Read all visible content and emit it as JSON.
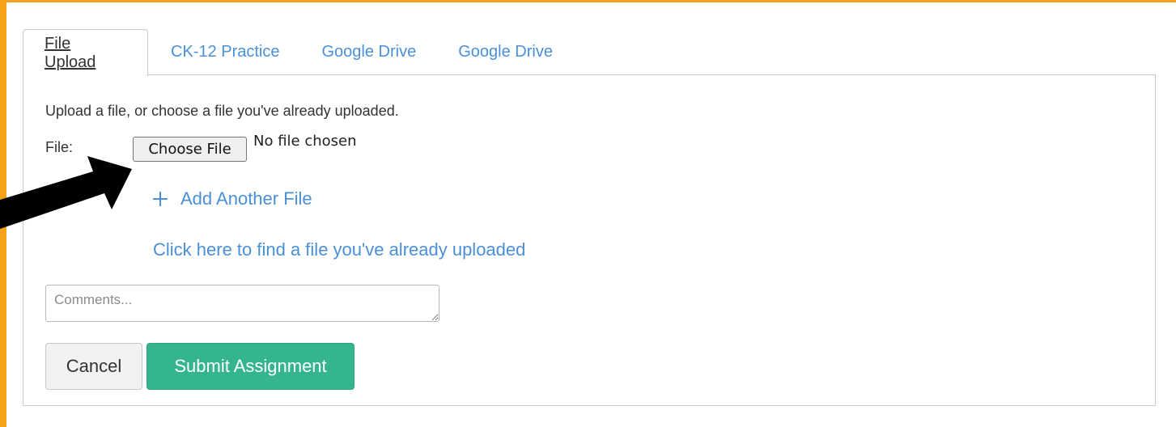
{
  "tabs": [
    {
      "label": "File Upload",
      "active": true
    },
    {
      "label": "CK-12 Practice",
      "active": false
    },
    {
      "label": "Google Drive",
      "active": false
    },
    {
      "label": "Google Drive",
      "active": false
    }
  ],
  "upload": {
    "instructions": "Upload a file, or choose a file you've already uploaded.",
    "file_label": "File:",
    "choose_file_label": "Choose File",
    "no_file_text": "No file chosen",
    "add_another_label": "Add Another File",
    "find_uploaded_link": "Click here to find a file you've already uploaded"
  },
  "comments": {
    "placeholder": "Comments..."
  },
  "actions": {
    "cancel_label": "Cancel",
    "submit_label": "Submit Assignment"
  },
  "colors": {
    "border_accent": "#f7a21b",
    "link": "#4a90d6",
    "submit_bg": "#35b58f",
    "arrow": "#000000"
  },
  "icons": [
    "plus-icon",
    "pointer-arrow-icon"
  ]
}
